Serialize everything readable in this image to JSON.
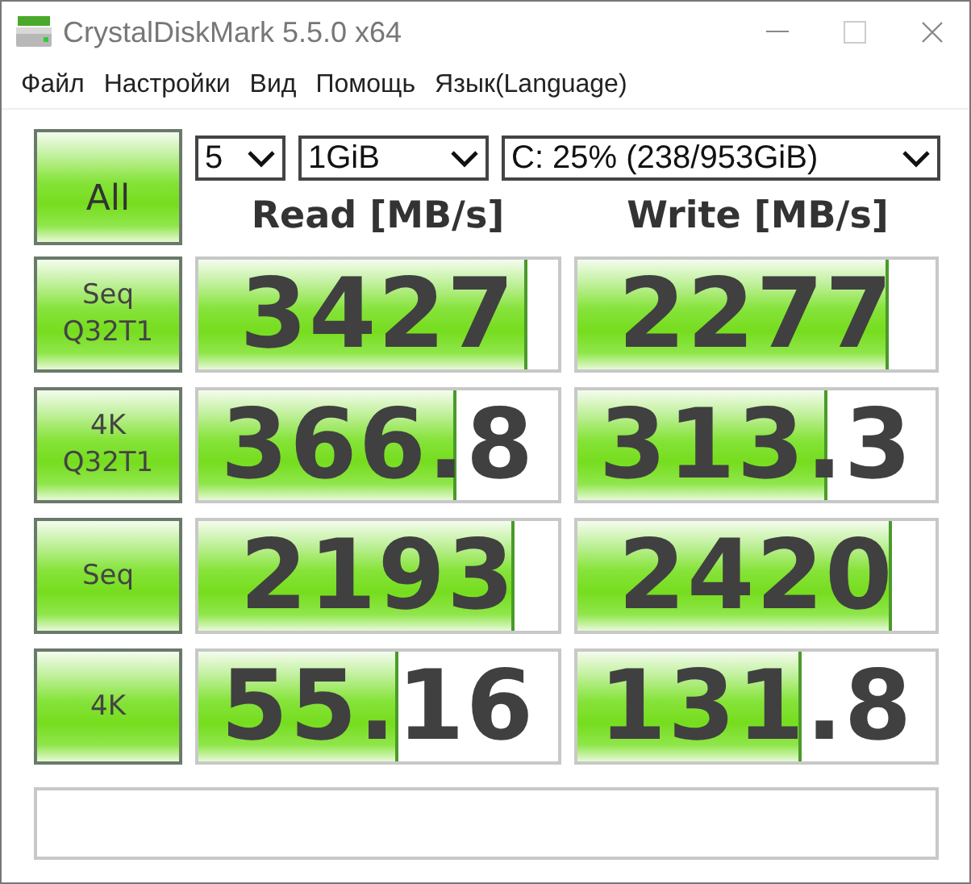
{
  "window": {
    "title": "CrystalDiskMark 5.5.0 x64"
  },
  "menu": [
    "Файл",
    "Настройки",
    "Вид",
    "Помощь",
    "Язык(Language)"
  ],
  "all_button": "All",
  "selectors": [
    {
      "value": "5"
    },
    {
      "value": "1GiB"
    },
    {
      "value": "C: 25% (238/953GiB)"
    }
  ],
  "columns": [
    "Read [MB/s]",
    "Write [MB/s]"
  ],
  "tests": [
    {
      "label": "Seq Q32T1",
      "results": [
        {
          "value": "3427",
          "level": 0.91
        },
        {
          "value": "2277",
          "level": 0.86
        }
      ]
    },
    {
      "label": "4K Q32T1",
      "results": [
        {
          "value": "366.8",
          "level": 0.71
        },
        {
          "value": "313.3",
          "level": 0.69
        }
      ]
    },
    {
      "label": "Seq",
      "results": [
        {
          "value": "2193",
          "level": 0.87
        },
        {
          "value": "2420",
          "level": 0.87
        }
      ]
    },
    {
      "label": "4K",
      "results": [
        {
          "value": "55.16",
          "level": 0.55
        },
        {
          "value": "131.8",
          "level": 0.62
        }
      ]
    }
  ]
}
